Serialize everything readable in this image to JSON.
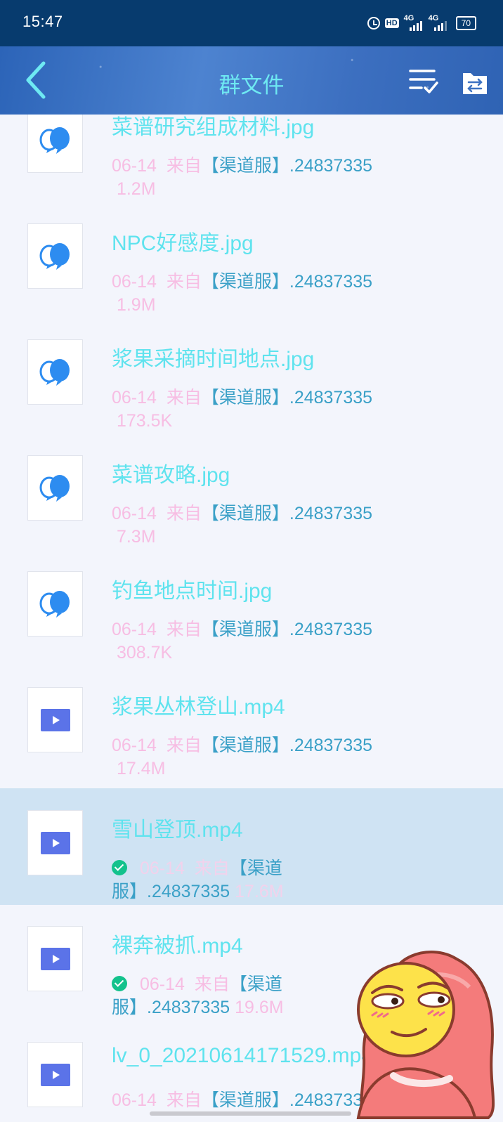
{
  "status_bar": {
    "time": "15:47",
    "hd_label": "HD",
    "network_1": "4G",
    "network_2": "4G",
    "battery": "70"
  },
  "header": {
    "title": "群文件",
    "back_icon": "chevron-left-icon",
    "multiselect_icon": "list-check-icon",
    "transfer_icon": "transfer-icon"
  },
  "files": [
    {
      "name": "菜谱研究组成材料.jpg",
      "date": "06-14",
      "from": "来自",
      "uploader": "【渠道服】.24837335",
      "size": "1.2M",
      "type": "image",
      "downloaded": false,
      "selected": false
    },
    {
      "name": "NPC好感度.jpg",
      "date": "06-14",
      "from": "来自",
      "uploader": "【渠道服】.24837335",
      "size": "1.9M",
      "type": "image",
      "downloaded": false,
      "selected": false
    },
    {
      "name": "浆果采摘时间地点.jpg",
      "date": "06-14",
      "from": "来自",
      "uploader": "【渠道服】.24837335",
      "size": "173.5K",
      "type": "image",
      "downloaded": false,
      "selected": false
    },
    {
      "name": "菜谱攻略.jpg",
      "date": "06-14",
      "from": "来自",
      "uploader": "【渠道服】.24837335",
      "size": "7.3M",
      "type": "image",
      "downloaded": false,
      "selected": false
    },
    {
      "name": "钓鱼地点时间.jpg",
      "date": "06-14",
      "from": "来自",
      "uploader": "【渠道服】.24837335",
      "size": "308.7K",
      "type": "image",
      "downloaded": false,
      "selected": false
    },
    {
      "name": "浆果丛林登山.mp4",
      "date": "06-14",
      "from": "来自",
      "uploader": "【渠道服】.24837335",
      "size": "17.4M",
      "type": "video",
      "downloaded": false,
      "selected": false
    },
    {
      "name": "雪山登顶.mp4",
      "date": "06-14",
      "from": "来自",
      "uploader": "【渠道服】.24837335",
      "size": "17.6M",
      "type": "video",
      "downloaded": true,
      "selected": true
    },
    {
      "name": "裸奔被抓.mp4",
      "date": "06-14",
      "from": "来自",
      "uploader": "【渠道服】.24837335",
      "size": "19.6M",
      "type": "video",
      "downloaded": true,
      "selected": false
    },
    {
      "name": "lv_0_20210614171529.mp4",
      "date": "06-14",
      "from": "来自",
      "uploader": "【渠道服】.24837335",
      "size": "",
      "type": "video",
      "downloaded": false,
      "selected": false
    }
  ],
  "colors": {
    "status_bar": "#073b6e",
    "header_accent": "#6ee9f2",
    "file_name": "#5fe3ee",
    "meta_pink": "#f7bde3",
    "uploader_blue": "#3aa0c7",
    "selected_row": "#cfe3f3",
    "download_check": "#13c28c",
    "video_icon": "#5b73e8",
    "image_icon": "#2d8cf0"
  },
  "overlay": {
    "sticker_icon": "smirking-emoji-sticker"
  }
}
